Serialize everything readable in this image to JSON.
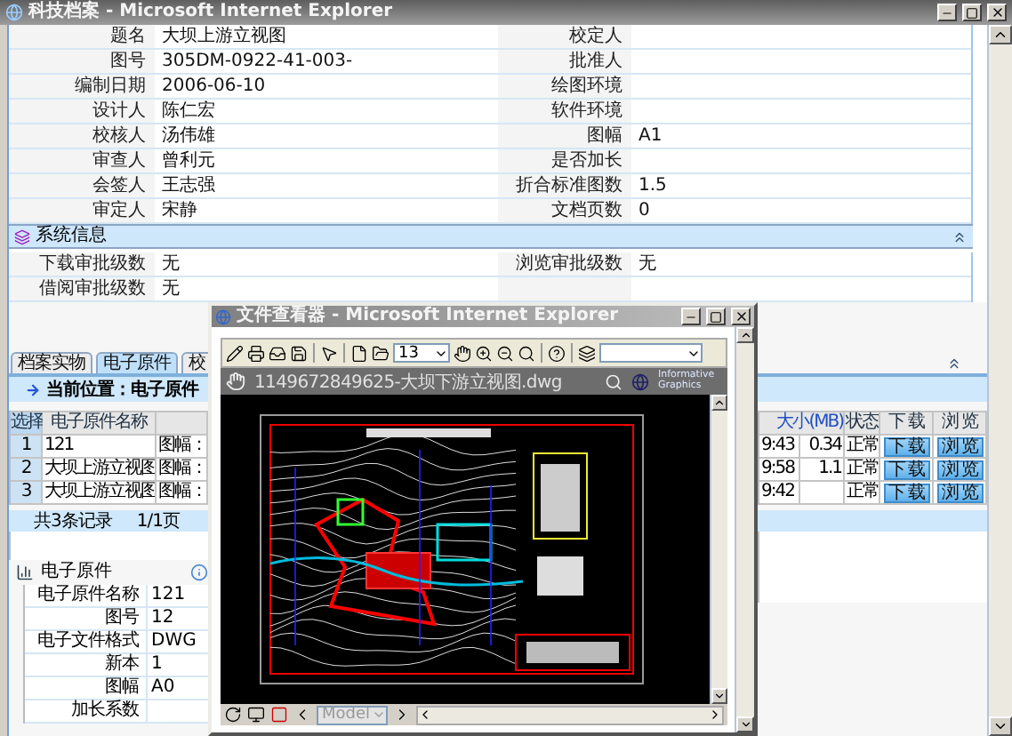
{
  "window": {
    "title": "科技档案 - Microsoft Internet Explorer"
  },
  "form": {
    "rows": [
      {
        "label": "题名",
        "value": "大坝上游立视图",
        "label_2": "校定人"
      },
      {
        "label": "图号",
        "value": "305DM-0922-41-003-",
        "label_2": "批准人"
      },
      {
        "label": "编制日期",
        "value": "2006-06-10",
        "label_2": "绘图环境"
      },
      {
        "label": "设计人",
        "value": "陈仁宏",
        "label_2": "软件环境"
      },
      {
        "label": "校核人",
        "value": "汤伟雄",
        "label_2": "图幅",
        "value_2": "A1"
      },
      {
        "label": "审查人",
        "value": "曾利元",
        "label_2": "是否加长"
      },
      {
        "label": "会签人",
        "value": "王志强",
        "label_2": "折合标准图数",
        "value_2": "1.5"
      },
      {
        "label": "审定人",
        "value": "宋静",
        "label_2": "文档页数",
        "value_2": "0"
      }
    ]
  },
  "system_info": {
    "title": "系统信息",
    "rows": [
      {
        "label": "下载审批级数",
        "value": "无",
        "label_2": "浏览审批级数",
        "value_2": "无"
      },
      {
        "label": "借阅审批级数",
        "value": "无"
      }
    ]
  },
  "tabs": [
    {
      "label": "档案实物",
      "selected": false
    },
    {
      "label": "电子原件",
      "selected": true
    },
    {
      "label": "校",
      "selected": false
    }
  ],
  "location": "当前位置：电子原件",
  "files_table": {
    "columns": [
      "选择",
      "电子原件名称"
    ],
    "columns_right": [
      "大小(MB)",
      "状态",
      "下 载",
      "浏 览"
    ],
    "rows": [
      {
        "index": "1",
        "name": "121",
        "column_3": "图幅：",
        "column_4": "9:43",
        "size": "0.34",
        "status": "正常",
        "download": "下 载",
        "view": "浏 览"
      },
      {
        "index": "2",
        "name": "大坝上游立视图",
        "column_3": "图幅：",
        "column_4": "9:58",
        "size": "1.1",
        "status": "正常",
        "download": "下 载",
        "view": "浏 览"
      },
      {
        "index": "3",
        "name": "大坝上游立视图",
        "column_3": "图幅：",
        "column_4": "9:42",
        "status": "正常",
        "download": "下 载",
        "view": "浏 览"
      }
    ]
  },
  "pager": {
    "count": "共3条记录",
    "pages": "1/1页"
  },
  "detail": {
    "title": "电子原件",
    "rows": [
      {
        "label": "电子原件名称",
        "value": "121"
      },
      {
        "label": "图号",
        "value": "12"
      },
      {
        "label": "电子文件格式",
        "value": "DWG"
      },
      {
        "label": "新本",
        "value": "1"
      },
      {
        "label": "图幅",
        "value": "A0"
      },
      {
        "label": "加长系数"
      }
    ]
  },
  "viewer": {
    "title": "文件查看器 - Microsoft Internet Explorer",
    "page": "13",
    "file": "1149672849625-大坝下游立视图.dwg",
    "logo": "Informative Graphics",
    "layout": "Model"
  }
}
